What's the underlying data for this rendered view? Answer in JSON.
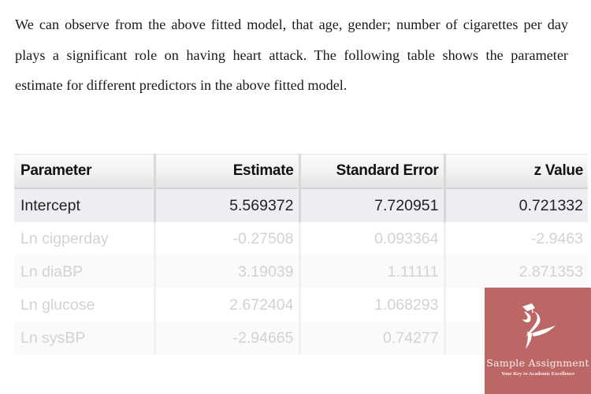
{
  "document": {
    "paragraph": "We can observe from the above fitted model, that age, gender; number of cigarettes per day plays a significant role on having heart attack. The following table shows the parameter estimate for different predictors in the above fitted model."
  },
  "table": {
    "headers": [
      "Parameter",
      "Estimate",
      "Standard Error",
      "z Value"
    ],
    "rows": [
      {
        "parameter": "Intercept",
        "estimate": "5.569372",
        "standard_error": "7.720951",
        "z_value": "0.721332"
      },
      {
        "parameter": "Ln cigperday",
        "estimate": "-0.27508",
        "standard_error": "0.093364",
        "z_value": "-2.9463"
      },
      {
        "parameter": "Ln diaBP",
        "estimate": "3.19039",
        "standard_error": "1.11111",
        "z_value": "2.871353"
      },
      {
        "parameter": "Ln glucose",
        "estimate": "2.672404",
        "standard_error": "1.068293",
        "z_value": ""
      },
      {
        "parameter": "Ln sysBP",
        "estimate": "-2.94665",
        "standard_error": "0.74277",
        "z_value": ""
      }
    ]
  },
  "watermark": {
    "title": "Sample Assignment",
    "tagline": "Your Key to Academic Excellence",
    "icon": "graduate-figure-icon",
    "background_color": "#bc6665"
  }
}
